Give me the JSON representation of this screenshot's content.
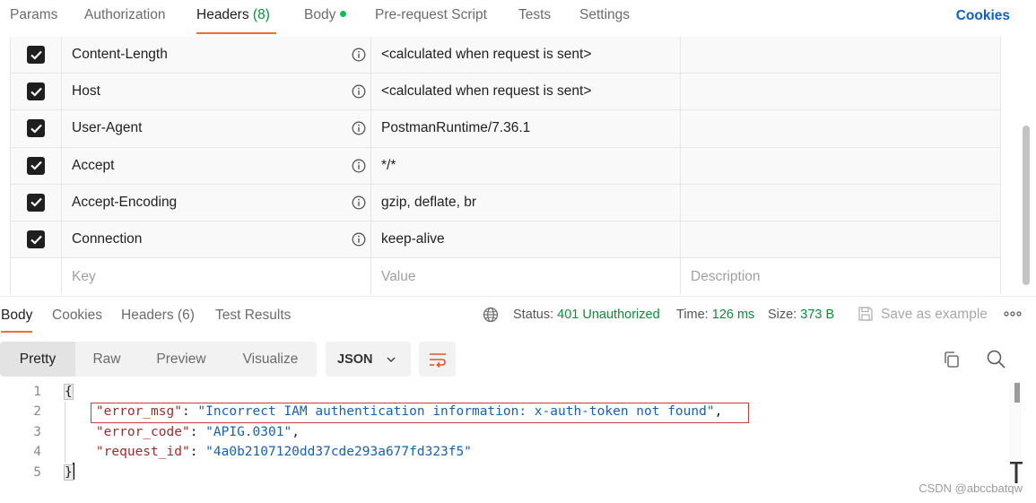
{
  "request_tabs": {
    "params": "Params",
    "authorization": "Authorization",
    "headers": "Headers",
    "headers_count": "(8)",
    "body": "Body",
    "prerequest": "Pre-request Script",
    "tests": "Tests",
    "settings": "Settings",
    "cookies": "Cookies"
  },
  "headers_table": {
    "rows": [
      {
        "key": "Content-Length",
        "value": "<calculated when request is sent>"
      },
      {
        "key": "Host",
        "value": "<calculated when request is sent>"
      },
      {
        "key": "User-Agent",
        "value": "PostmanRuntime/7.36.1"
      },
      {
        "key": "Accept",
        "value": "*/*"
      },
      {
        "key": "Accept-Encoding",
        "value": "gzip, deflate, br"
      },
      {
        "key": "Connection",
        "value": "keep-alive"
      }
    ],
    "placeholder": {
      "key": "Key",
      "value": "Value",
      "description": "Description"
    }
  },
  "response": {
    "tabs": {
      "body": "Body",
      "cookies": "Cookies",
      "headers": "Headers",
      "headers_count": "(6)",
      "test_results": "Test Results"
    },
    "status_label": "Status:",
    "status_value": "401 Unauthorized",
    "time_label": "Time:",
    "time_value": "126 ms",
    "size_label": "Size:",
    "size_value": "373 B",
    "save_as_example": "Save as example"
  },
  "format": {
    "pretty": "Pretty",
    "raw": "Raw",
    "preview": "Preview",
    "visualize": "Visualize",
    "language": "JSON"
  },
  "code": {
    "line_numbers": [
      "1",
      "2",
      "3",
      "4",
      "5"
    ],
    "open_brace": "{",
    "close_brace": "}",
    "entries": [
      {
        "key": "\"error_msg\"",
        "sep": ": ",
        "value": "\"Incorrect IAM authentication information: x-auth-token not found\"",
        "tail": ","
      },
      {
        "key": "\"error_code\"",
        "sep": ": ",
        "value": "\"APIG.0301\"",
        "tail": ","
      },
      {
        "key": "\"request_id\"",
        "sep": ": ",
        "value": "\"4a0b2107120dd37cde293a677fd323f5\"",
        "tail": ""
      }
    ]
  },
  "watermark": "CSDN @abccbatqw",
  "colors": {
    "accent_tab": "#f26b3a",
    "status_green": "#0f8a3a",
    "cookies_blue": "#0b60c7",
    "json_key": "#9b2d2d",
    "json_string": "#1a5fb4",
    "highlight_red": "#d23b3b"
  },
  "icons": {
    "checkbox": "checkmark-icon",
    "info": "info-icon",
    "globe": "globe-icon",
    "save": "save-icon",
    "more": "more-icon",
    "chevron": "chevron-down-icon",
    "wrap": "wrap-lines-icon",
    "copy": "copy-icon",
    "search": "search-icon"
  }
}
